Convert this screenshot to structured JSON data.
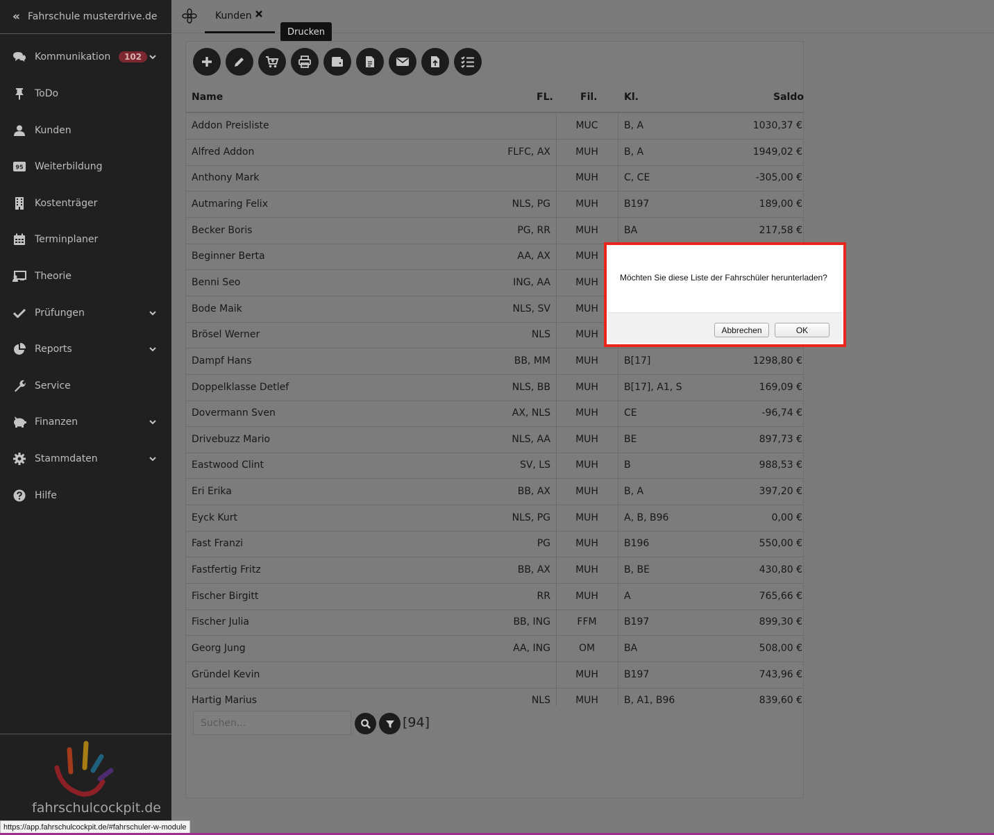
{
  "app": {
    "title": "Fahrschule musterdrive.de"
  },
  "sidebar": {
    "items": [
      {
        "label": "Kommunikation",
        "icon": "chat-icon",
        "badge": "102",
        "expandable": true
      },
      {
        "label": "ToDo",
        "icon": "pin-icon"
      },
      {
        "label": "Kunden",
        "icon": "user-icon"
      },
      {
        "label": "Weiterbildung",
        "icon": "95-badge-icon"
      },
      {
        "label": "Kostenträger",
        "icon": "building-icon"
      },
      {
        "label": "Terminplaner",
        "icon": "calendar-icon"
      },
      {
        "label": "Theorie",
        "icon": "presentation-icon"
      },
      {
        "label": "Prüfungen",
        "icon": "check-icon",
        "expandable": true
      },
      {
        "label": "Reports",
        "icon": "pie-chart-icon",
        "expandable": true
      },
      {
        "label": "Service",
        "icon": "wrench-icon"
      },
      {
        "label": "Finanzen",
        "icon": "piggy-bank-icon",
        "expandable": true
      },
      {
        "label": "Stammdaten",
        "icon": "gear-icon",
        "expandable": true
      },
      {
        "label": "Hilfe",
        "icon": "help-icon"
      }
    ],
    "logo_text": "fahrschulcockpit.de"
  },
  "tabs": [
    {
      "label": "Kunden"
    }
  ],
  "tooltip": "Drucken",
  "toolbar": [
    "add-icon",
    "edit-icon",
    "cart-icon",
    "print-icon",
    "wallet-icon",
    "document-icon",
    "mail-icon",
    "upload-file-icon",
    "checklist-icon"
  ],
  "table": {
    "headers": {
      "name": "Name",
      "fl": "FL.",
      "fil": "Fil.",
      "kl": "Kl.",
      "saldo": "Saldo"
    },
    "rows": [
      {
        "name": "Addon Preisliste",
        "fl": "",
        "fil": "MUC",
        "kl": "B, A",
        "saldo": "1030,37 €"
      },
      {
        "name": "Alfred Addon",
        "fl": "FLFC, AX",
        "fil": "MUH",
        "kl": "B, A",
        "saldo": "1949,02 €"
      },
      {
        "name": "Anthony Mark",
        "fl": "",
        "fil": "MUH",
        "kl": "C, CE",
        "saldo": "-305,00 €"
      },
      {
        "name": "Autmaring Felix",
        "fl": "NLS, PG",
        "fil": "MUH",
        "kl": "B197",
        "saldo": "189,00 €"
      },
      {
        "name": "Becker Boris",
        "fl": "PG, RR",
        "fil": "MUH",
        "kl": "BA",
        "saldo": "217,58 €"
      },
      {
        "name": "Beginner Berta",
        "fl": "AA, AX",
        "fil": "MUH",
        "kl": "",
        "saldo": ""
      },
      {
        "name": "Benni Seo",
        "fl": "ING, AA",
        "fil": "MUH",
        "kl": "",
        "saldo": ""
      },
      {
        "name": "Bode Maik",
        "fl": "NLS, SV",
        "fil": "MUH",
        "kl": "",
        "saldo": ""
      },
      {
        "name": "Brösel Werner",
        "fl": "NLS",
        "fil": "MUH",
        "kl": "",
        "saldo": ""
      },
      {
        "name": "Dampf Hans",
        "fl": "BB, MM",
        "fil": "MUH",
        "kl": "B[17]",
        "saldo": "1298,80 €"
      },
      {
        "name": "Doppelklasse Detlef",
        "fl": "NLS, BB",
        "fil": "MUH",
        "kl": "B[17], A1, S",
        "saldo": "169,09 €"
      },
      {
        "name": "Dovermann Sven",
        "fl": "AX, NLS",
        "fil": "MUH",
        "kl": "CE",
        "saldo": "-96,74 €"
      },
      {
        "name": "Drivebuzz Mario",
        "fl": "NLS, AA",
        "fil": "MUH",
        "kl": "BE",
        "saldo": "897,73 €"
      },
      {
        "name": "Eastwood Clint",
        "fl": "SV, LS",
        "fil": "MUH",
        "kl": "B",
        "saldo": "988,53 €"
      },
      {
        "name": "Eri Erika",
        "fl": "BB, AX",
        "fil": "MUH",
        "kl": "B, A",
        "saldo": "397,20 €"
      },
      {
        "name": "Eyck Kurt",
        "fl": "NLS, PG",
        "fil": "MUH",
        "kl": "A, B, B96",
        "saldo": "0,00 €"
      },
      {
        "name": "Fast Franzi",
        "fl": "PG",
        "fil": "MUH",
        "kl": "B196",
        "saldo": "550,00 €"
      },
      {
        "name": "Fastfertig Fritz",
        "fl": "BB, AX",
        "fil": "MUH",
        "kl": "B, BE",
        "saldo": "430,80 €"
      },
      {
        "name": "Fischer Birgitt",
        "fl": "RR",
        "fil": "MUH",
        "kl": "A",
        "saldo": "765,66 €"
      },
      {
        "name": "Fischer Julia",
        "fl": "BB, ING",
        "fil": "FFM",
        "kl": "B197",
        "saldo": "899,30 €"
      },
      {
        "name": "Georg Jung",
        "fl": "AA, ING",
        "fil": "OM",
        "kl": "BA",
        "saldo": "508,00 €"
      },
      {
        "name": "Gründel Kevin",
        "fl": "",
        "fil": "MUH",
        "kl": "B197",
        "saldo": "743,96 €"
      },
      {
        "name": "Hartig Marius",
        "fl": "NLS",
        "fil": "MUH",
        "kl": "B, A1, B96",
        "saldo": "839,60 €"
      }
    ]
  },
  "search": {
    "placeholder": "Suchen...",
    "count": "[94]"
  },
  "dialog": {
    "message": "Möchten Sie diese Liste der Fahrschüler herunterladen?",
    "cancel": "Abbrechen",
    "ok": "OK"
  },
  "status_url": "https://app.fahrschulcockpit.de/#fahrschuler-w-module"
}
